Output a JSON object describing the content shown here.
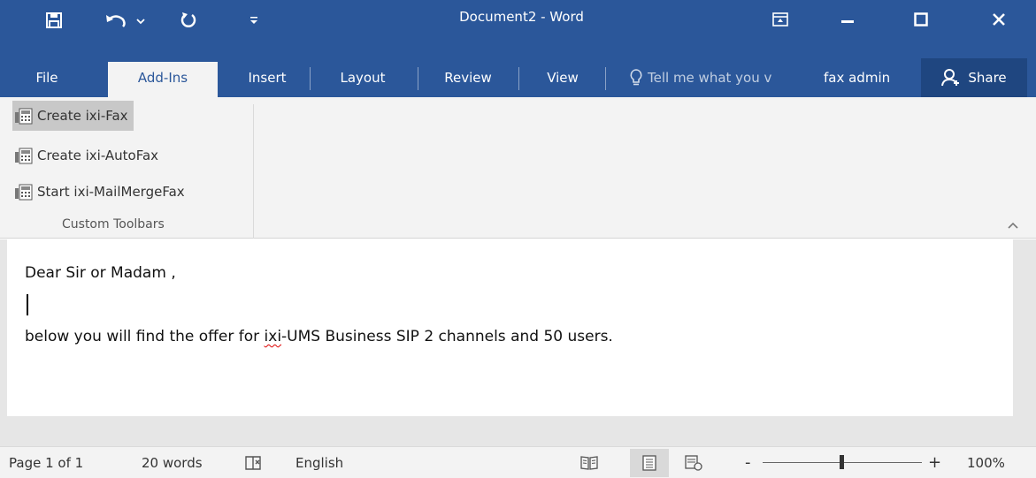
{
  "window": {
    "title": "Document2 - Word"
  },
  "qat": {
    "save_icon": "save-icon",
    "undo_icon": "undo-icon",
    "redo_icon": "redo-icon",
    "customize_icon": "customize-qat-icon"
  },
  "tabs": {
    "file": "File",
    "addins": "Add-Ins",
    "insert": "Insert",
    "layout": "Layout",
    "review": "Review",
    "view": "View",
    "tellme": "Tell me what you v",
    "user": "fax admin",
    "share": "Share"
  },
  "ribbon": {
    "items": [
      {
        "label": "Create ixi-Fax",
        "icon": "fax-icon",
        "selected": true
      },
      {
        "label": "Create ixi-AutoFax",
        "icon": "fax-icon",
        "selected": false
      },
      {
        "label": "Start ixi-MailMergeFax",
        "icon": "fax-icon",
        "selected": false
      }
    ],
    "group_label": "Custom Toolbars"
  },
  "document": {
    "line1": "Dear Sir or Madam ,",
    "line3_before": "below you will find the offer for ",
    "line3_misspelled": "ixi",
    "line3_after": "-UMS Business SIP 2 channels and 50 users."
  },
  "status": {
    "page": "Page 1 of 1",
    "words": "20 words",
    "language": "English",
    "zoom": "100%",
    "zoom_minus": "-",
    "zoom_plus": "+"
  },
  "colors": {
    "accent": "#2b579a",
    "ribbon_bg": "#f3f3f3"
  }
}
